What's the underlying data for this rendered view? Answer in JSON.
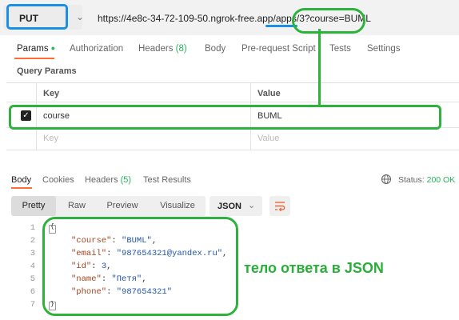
{
  "request": {
    "method": "PUT",
    "url_prefix": "https://4e8c-34-72-109-50.ngrok-free.app/",
    "url_apps": "apps",
    "url_slash": "/",
    "url_id": "3",
    "url_query": "?course=BUML"
  },
  "request_tabs": [
    {
      "label": "Params"
    },
    {
      "label": "Authorization"
    },
    {
      "label": "Headers",
      "count": "(8)"
    },
    {
      "label": "Body"
    },
    {
      "label": "Pre-request Script"
    },
    {
      "label": "Tests"
    },
    {
      "label": "Settings"
    }
  ],
  "query_params": {
    "title": "Query Params",
    "headers": {
      "key": "Key",
      "value": "Value"
    },
    "rows": [
      {
        "checked": true,
        "key": "course",
        "value": "BUML"
      }
    ],
    "placeholders": {
      "key": "Key",
      "value": "Value"
    }
  },
  "response_tabs": [
    {
      "label": "Body"
    },
    {
      "label": "Cookies"
    },
    {
      "label": "Headers",
      "count": "(5)"
    },
    {
      "label": "Test Results"
    }
  ],
  "status": {
    "label": "Status:",
    "value": "200 OK"
  },
  "format_buttons": [
    "Pretty",
    "Raw",
    "Preview",
    "Visualize"
  ],
  "format_select": "JSON",
  "response_body": {
    "line_numbers": [
      "1",
      "2",
      "3",
      "4",
      "5",
      "6",
      "7"
    ],
    "open_brace": "{",
    "close_brace": "}",
    "fields": [
      {
        "key": "\"course\"",
        "value": "\"BUML\"",
        "type": "string"
      },
      {
        "key": "\"email\"",
        "value": "\"987654321@yandex.ru\"",
        "type": "string"
      },
      {
        "key": "\"id\"",
        "value": "3",
        "type": "number"
      },
      {
        "key": "\"name\"",
        "value": "\"Петя\"",
        "type": "string"
      },
      {
        "key": "\"phone\"",
        "value": "\"987654321\"",
        "type": "string"
      }
    ]
  },
  "annotation": {
    "text": "тело ответа в JSON"
  },
  "colors": {
    "accent": "#ff6c37",
    "success": "#26b557",
    "annotation_green": "#2db33c",
    "annotation_blue": "#1a8fe3"
  }
}
